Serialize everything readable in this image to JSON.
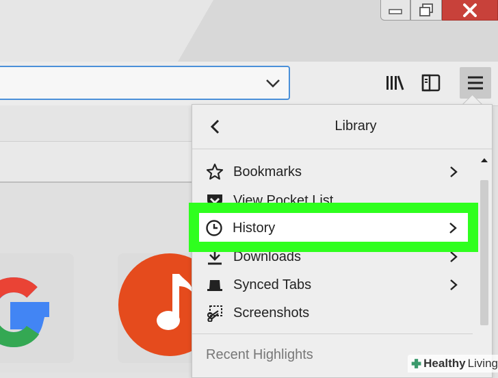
{
  "menu": {
    "title": "Library",
    "items": [
      {
        "label": "Bookmarks",
        "icon": "star-icon",
        "has_submenu": true
      },
      {
        "label": "View Pocket List",
        "icon": "pocket-icon",
        "has_submenu": false
      },
      {
        "label": "History",
        "icon": "clock-icon",
        "has_submenu": true
      },
      {
        "label": "Downloads",
        "icon": "download-icon",
        "has_submenu": true
      },
      {
        "label": "Synced Tabs",
        "icon": "synced-tabs-icon",
        "has_submenu": true
      },
      {
        "label": "Screenshots",
        "icon": "screenshot-icon",
        "has_submenu": false
      }
    ],
    "section_label": "Recent Highlights"
  },
  "highlighted_item": "History",
  "colors": {
    "highlight": "#2fff1e",
    "close_button": "#c8413a",
    "urlbar_focus": "#4a90d9",
    "music_tile": "#e54b1d"
  },
  "watermark": {
    "brand_bold": "Healthy",
    "brand_rest": "Living"
  }
}
